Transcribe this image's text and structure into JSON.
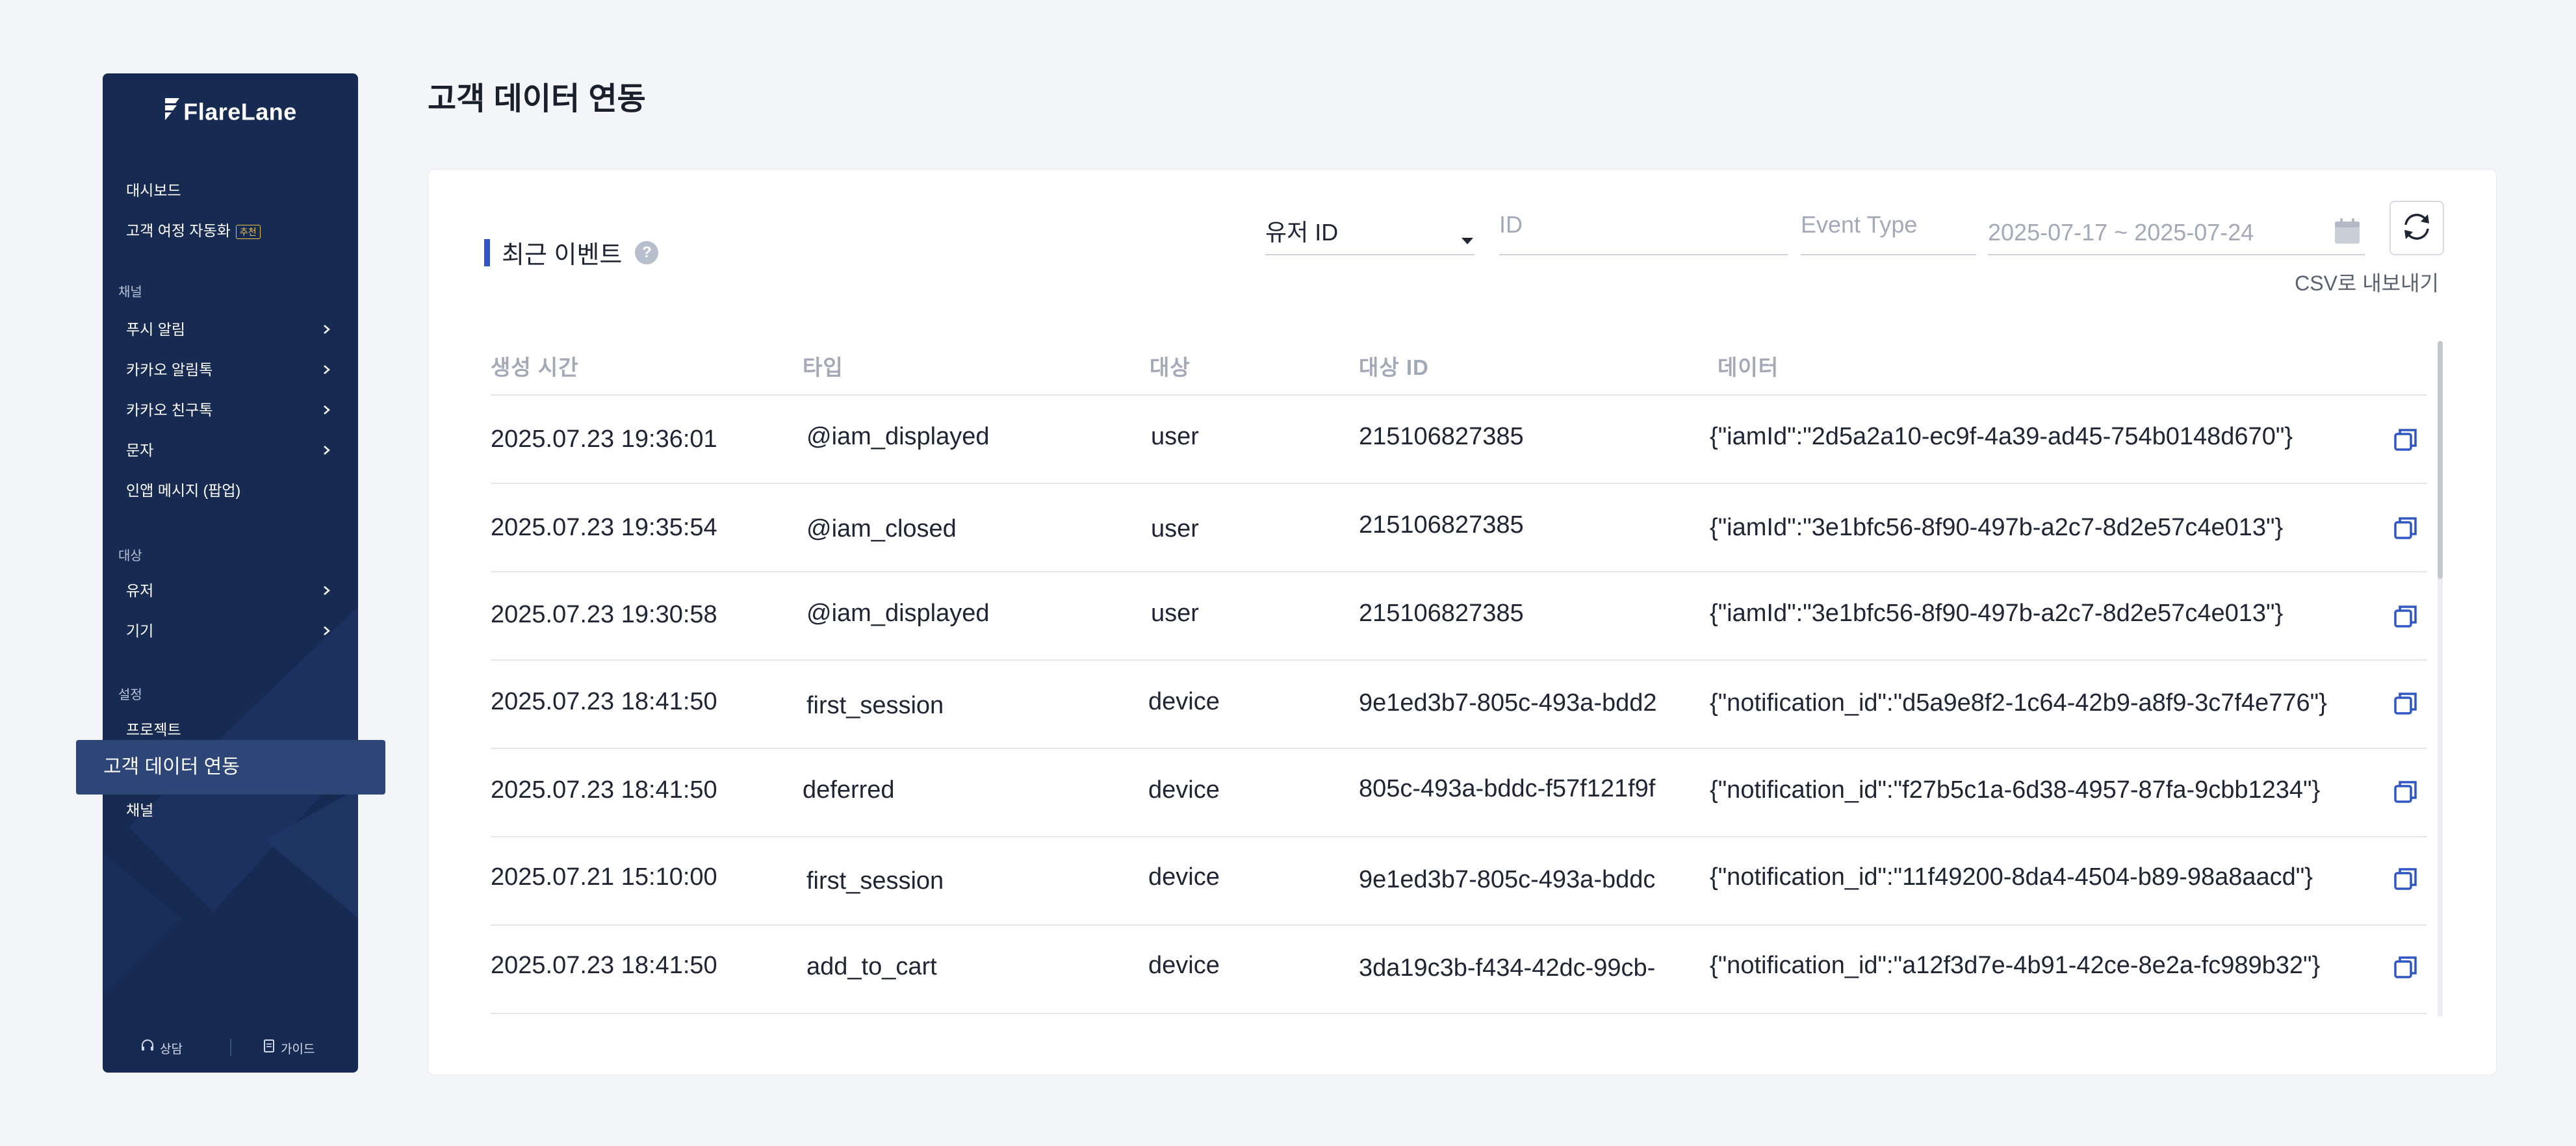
{
  "sidebar": {
    "logo": "FlareLane",
    "sections": [
      {
        "label": "",
        "items": [
          {
            "label": "대시보드"
          },
          {
            "label": "고객 여정 자동화",
            "badge": "추천"
          }
        ]
      },
      {
        "label": "채널",
        "items": [
          {
            "label": "푸시 알림",
            "expandable": true
          },
          {
            "label": "카카오 알림톡",
            "expandable": true
          },
          {
            "label": "카카오 친구톡",
            "expandable": true
          },
          {
            "label": "문자",
            "expandable": true
          },
          {
            "label": "인앱 메시지 (팝업)"
          }
        ]
      },
      {
        "label": "대상",
        "items": [
          {
            "label": "유저",
            "expandable": true
          },
          {
            "label": "기기",
            "expandable": true
          }
        ]
      },
      {
        "label": "설정",
        "items": [
          {
            "label": "프로젝트"
          },
          {
            "label": "고객 데이터 연동",
            "active": true
          },
          {
            "label": "채널"
          }
        ]
      }
    ],
    "footer": {
      "consult": "상담",
      "guide": "가이드"
    }
  },
  "page": {
    "title": "고객 데이터 연동"
  },
  "events": {
    "title": "최근 이벤트",
    "help_icon": "?",
    "filters": {
      "id_type": "유저 ID",
      "id_placeholder": "ID",
      "event_type_placeholder": "Event Type",
      "date_range": "2025-07-17 ~ 2025-07-24"
    },
    "export_label": "CSV로 내보내기",
    "columns": [
      "생성 시간",
      "타입",
      "대상",
      "대상 ID",
      "데이터"
    ],
    "rows": [
      {
        "created": "2025.07.23 19:36:01",
        "type": "@iam_displayed",
        "target": "user",
        "target_id": "215106827385",
        "data": "{\"iamId\":\"2d5a2a10-ec9f-4a39-ad45-754b0148d670\"}"
      },
      {
        "created": "2025.07.23 19:35:54",
        "type": "@iam_closed",
        "target": "user",
        "target_id": "215106827385",
        "data": "{\"iamId\":\"3e1bfc56-8f90-497b-a2c7-8d2e57c4e013\"}"
      },
      {
        "created": "2025.07.23 19:30:58",
        "type": "@iam_displayed",
        "target": "user",
        "target_id": "215106827385",
        "data": "{\"iamId\":\"3e1bfc56-8f90-497b-a2c7-8d2e57c4e013\"}"
      },
      {
        "created": "2025.07.23 18:41:50",
        "type": "first_session",
        "target": "device",
        "target_id": "9e1ed3b7-805c-493a-bdd2",
        "data": "{\"notification_id\":\"d5a9e8f2-1c64-42b9-a8f9-3c7f4e776\"}"
      },
      {
        "created": "2025.07.23 18:41:50",
        "type": "deferred",
        "target": "device",
        "target_id": "805c-493a-bddc-f57f121f9f",
        "data": "{\"notification_id\":\"f27b5c1a-6d38-4957-87fa-9cbb1234\"}"
      },
      {
        "created": "2025.07.21 15:10:00",
        "type": "first_session",
        "target": "device",
        "target_id": "9e1ed3b7-805c-493a-bddc",
        "data": "{\"notification_id\":\"11f49200-8da4-4504-b89-98a8aacd\"}"
      },
      {
        "created": "2025.07.23 18:41:50",
        "type": "add_to_cart",
        "target": "device",
        "target_id": "3da19c3b-f434-42dc-99cb-",
        "data": "{\"notification_id\":\"a12f3d7e-4b91-42ce-8e2a-fc989b32\"}"
      }
    ]
  },
  "colors": {
    "sidebar_bg": "#172a52",
    "active_bg": "#2d4677",
    "accent": "#2f57c4",
    "badge": "#e9c24a"
  }
}
